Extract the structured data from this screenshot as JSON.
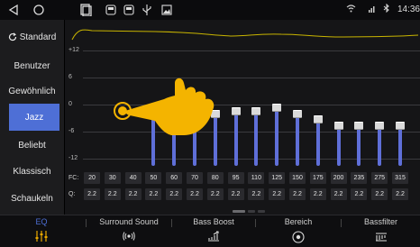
{
  "status_bar": {
    "icons": [
      "back-icon",
      "home-icon",
      "recent-icon",
      "screenshot-icon",
      "screenshot-icon",
      "usb-icon",
      "image-icon"
    ],
    "bluetooth_icon": "bluetooth-icon",
    "wifi_icon": "wifi-icon",
    "signal_icon": "signal-icon",
    "time": "14:36"
  },
  "sidebar": {
    "refresh_icon": "refresh-icon",
    "items": [
      {
        "label": "Standard"
      },
      {
        "label": "Benutzer"
      },
      {
        "label": "Gewöhnlich"
      },
      {
        "label": "Jazz",
        "selected": true
      },
      {
        "label": "Beliebt"
      },
      {
        "label": "Klassisch"
      },
      {
        "label": "Schaukeln"
      }
    ]
  },
  "equalizer": {
    "scale_labels": [
      "+12",
      "6",
      "0",
      "-6",
      "-12"
    ],
    "fc_label": "FC:",
    "q_label": "Q:",
    "bands": [
      {
        "fc": "20",
        "q": "2.2",
        "level": 0.0
      },
      {
        "fc": "30",
        "q": "2.2",
        "level": 0.0
      },
      {
        "fc": "40",
        "q": "2.2",
        "level": 0.0
      },
      {
        "fc": "50",
        "q": "2.2",
        "level": 0.55
      },
      {
        "fc": "60",
        "q": "2.2",
        "level": 0.52
      },
      {
        "fc": "70",
        "q": "2.2",
        "level": 0.52
      },
      {
        "fc": "80",
        "q": "2.2",
        "level": 0.49
      },
      {
        "fc": "95",
        "q": "2.2",
        "level": 0.52
      },
      {
        "fc": "110",
        "q": "2.2",
        "level": 0.52
      },
      {
        "fc": "125",
        "q": "2.2",
        "level": 0.55
      },
      {
        "fc": "150",
        "q": "2.2",
        "level": 0.49
      },
      {
        "fc": "175",
        "q": "2.2",
        "level": 0.44
      },
      {
        "fc": "200",
        "q": "2.2",
        "level": 0.38
      },
      {
        "fc": "235",
        "q": "2.2",
        "level": 0.38
      },
      {
        "fc": "275",
        "q": "2.2",
        "level": 0.38
      },
      {
        "fc": "315",
        "q": "2.2",
        "level": 0.38
      }
    ]
  },
  "tabs": [
    {
      "label": "EQ",
      "icon": "equalizer-icon",
      "active": true
    },
    {
      "label": "Surround Sound",
      "icon": "surround-icon",
      "active": false
    },
    {
      "label": "Bass Boost",
      "icon": "bass-boost-icon",
      "active": false
    },
    {
      "label": "Bereich",
      "icon": "area-icon",
      "active": false
    },
    {
      "label": "Bassfilter",
      "icon": "bass-filter-icon",
      "active": false
    }
  ],
  "colors": {
    "accent": "#4e6fd6",
    "curve": "#c8b400",
    "hand": "#f4b400"
  }
}
